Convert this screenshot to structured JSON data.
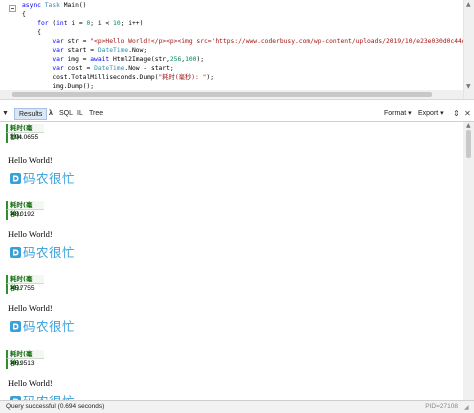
{
  "editor": {
    "lines": [
      [
        {
          "t": "async ",
          "c": "kw"
        },
        {
          "t": "Task ",
          "c": "ty"
        },
        {
          "t": "Main()",
          "c": ""
        }
      ],
      [
        {
          "t": "{",
          "c": ""
        }
      ],
      [
        {
          "t": "    ",
          "c": ""
        },
        {
          "t": "for ",
          "c": "kw"
        },
        {
          "t": "(",
          "c": ""
        },
        {
          "t": "int ",
          "c": "kw"
        },
        {
          "t": "i = ",
          "c": ""
        },
        {
          "t": "0",
          "c": "nm"
        },
        {
          "t": "; i < ",
          "c": ""
        },
        {
          "t": "10",
          "c": "nm"
        },
        {
          "t": "; i++)",
          "c": ""
        }
      ],
      [
        {
          "t": "    {",
          "c": ""
        }
      ],
      [
        {
          "t": "        ",
          "c": ""
        },
        {
          "t": "var ",
          "c": "kw"
        },
        {
          "t": "str = ",
          "c": ""
        },
        {
          "t": "\"<p>Hello World!</p><p><img src='https://www.coderbusy.com/wp-content/uploads/2019/10/e23e030d0c44d75.png'></p>\"",
          "c": "st"
        },
        {
          "t": ";",
          "c": ""
        }
      ],
      [
        {
          "t": "        ",
          "c": ""
        },
        {
          "t": "var ",
          "c": "kw"
        },
        {
          "t": "start = ",
          "c": ""
        },
        {
          "t": "DateTime",
          "c": "ty"
        },
        {
          "t": ".Now;",
          "c": ""
        }
      ],
      [
        {
          "t": "        ",
          "c": ""
        },
        {
          "t": "var ",
          "c": "kw"
        },
        {
          "t": "img = ",
          "c": ""
        },
        {
          "t": "await ",
          "c": "kw"
        },
        {
          "t": "Html2Image(str,",
          "c": ""
        },
        {
          "t": "256",
          "c": "nm"
        },
        {
          "t": ",",
          "c": ""
        },
        {
          "t": "100",
          "c": "nm"
        },
        {
          "t": ");",
          "c": ""
        }
      ],
      [
        {
          "t": "        ",
          "c": ""
        },
        {
          "t": "var ",
          "c": "kw"
        },
        {
          "t": "cost = ",
          "c": ""
        },
        {
          "t": "DateTime",
          "c": "ty"
        },
        {
          "t": ".Now - start;",
          "c": ""
        }
      ],
      [
        {
          "t": "        cost.TotalMilliseconds.Dump(",
          "c": ""
        },
        {
          "t": "\"耗时(毫秒): \"",
          "c": "st"
        },
        {
          "t": ");",
          "c": ""
        }
      ],
      [
        {
          "t": "        img.Dump();",
          "c": ""
        }
      ],
      [
        {
          "t": "    }",
          "c": ""
        }
      ],
      [
        {
          "t": "}",
          "c": ""
        }
      ]
    ]
  },
  "toolbar": {
    "tabs": [
      {
        "label": "Results"
      },
      {
        "label": "λ"
      },
      {
        "label": "SQL"
      },
      {
        "label": "IL"
      },
      {
        "label": "Tree"
      }
    ],
    "format_label": "Format ▾",
    "export_label": "Export ▾",
    "collapse_glyph": "⇕",
    "close_glyph": "✕"
  },
  "results": {
    "dump_header": "耗时(毫秒):",
    "hello_text": "Hello World!",
    "logo_text": "码农很忙",
    "timings": [
      "194.0655",
      "48.0192",
      "45.7755",
      "46.9513"
    ]
  },
  "colors": {
    "accent_green": "#2f8f2f",
    "logo_blue": "#39a0d8"
  },
  "status": {
    "text": "Query successful  (0.694 seconds)",
    "pid": "PID=27108"
  }
}
